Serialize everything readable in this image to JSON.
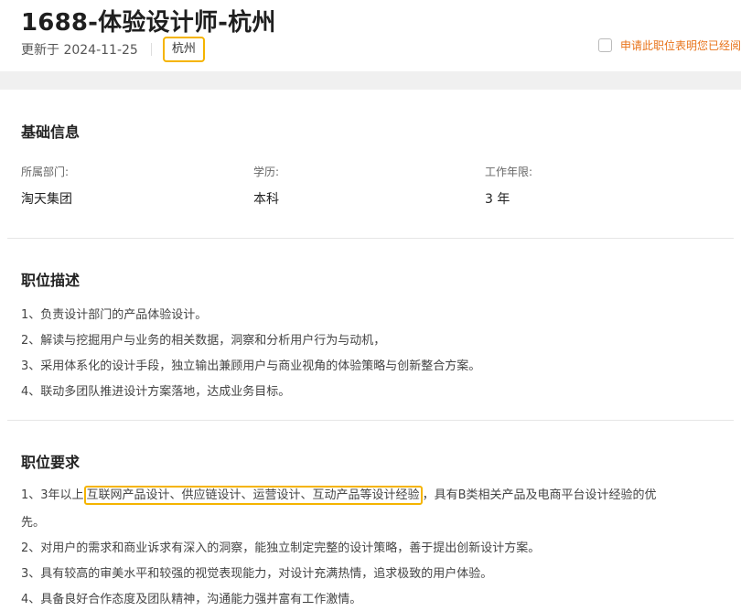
{
  "job": {
    "title": "1688-体验设计师-杭州",
    "updated": "更新于 2024-11-25",
    "city": "杭州",
    "apply_notice": "申请此职位表明您已经阅"
  },
  "basic_info": {
    "heading": "基础信息",
    "fields": [
      {
        "label": "所属部门:",
        "value": "淘天集团"
      },
      {
        "label": "学历:",
        "value": "本科"
      },
      {
        "label": "工作年限:",
        "value": "3 年"
      }
    ]
  },
  "description": {
    "heading": "职位描述",
    "items": [
      "1、负责设计部门的产品体验设计。",
      "2、解读与挖掘用户与业务的相关数据，洞察和分析用户行为与动机，",
      "3、采用体系化的设计手段，独立输出兼顾用户与商业视角的体验策略与创新整合方案。",
      "4、联动多团队推进设计方案落地，达成业务目标。"
    ]
  },
  "requirements": {
    "heading": "职位要求",
    "item1_prefix": "1、3年以上",
    "item1_highlight": "互联网产品设计、供应链设计、运营设计、互动产品等设计经验",
    "item1_suffix": "，具有B类相关产品及电商平台设计经验的优",
    "item1_wrap": "先。",
    "items": [
      "2、对用户的需求和商业诉求有深入的洞察，能独立制定完整的设计策略，善于提出创新设计方案。",
      "3、具有较高的审美水平和较强的视觉表现能力，对设计充满热情，追求极致的用户体验。",
      "4、具备良好合作态度及团队精神，沟通能力强并富有工作激情。"
    ]
  },
  "colors": {
    "highlight_border": "#f5b400",
    "apply_text": "#e8731a"
  }
}
